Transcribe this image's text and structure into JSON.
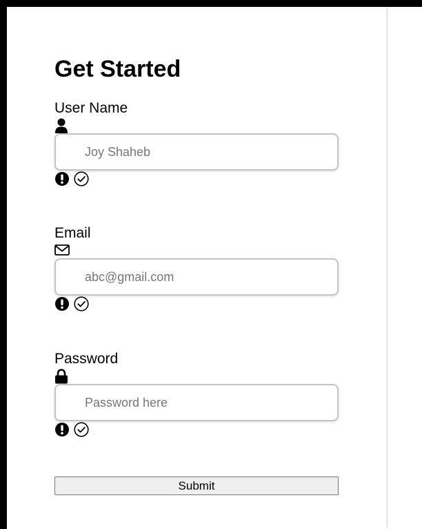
{
  "form": {
    "title": "Get Started",
    "fields": [
      {
        "label": "User Name",
        "icon": "user-icon",
        "type": "text",
        "value": "",
        "placeholder": "Joy Shaheb",
        "status_icons": [
          "error-icon",
          "success-icon"
        ]
      },
      {
        "label": "Email",
        "icon": "envelope-icon",
        "type": "email",
        "value": "",
        "placeholder": "abc@gmail.com",
        "status_icons": [
          "error-icon",
          "success-icon"
        ]
      },
      {
        "label": "Password",
        "icon": "lock-icon",
        "type": "password",
        "value": "",
        "placeholder": "Password here",
        "status_icons": [
          "error-icon",
          "success-icon"
        ]
      }
    ],
    "submit_label": "Submit"
  },
  "colors": {
    "background": "#ffffff",
    "frame": "#000000",
    "input_border": "#c4c4c4",
    "button_background": "#efefef"
  }
}
